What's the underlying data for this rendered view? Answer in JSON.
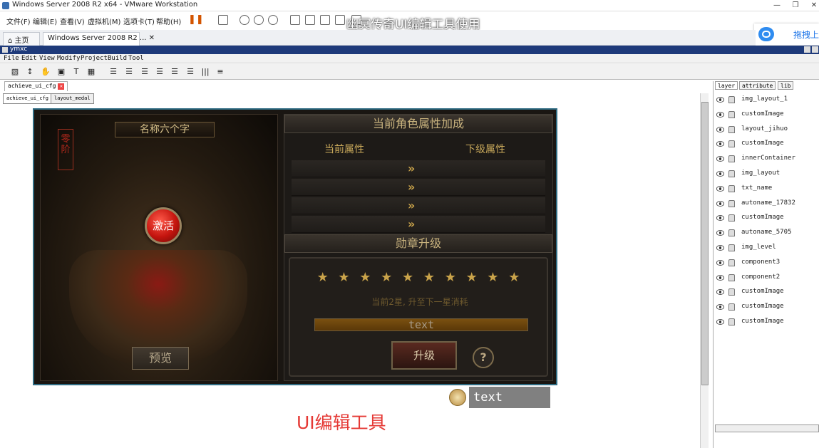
{
  "vmware": {
    "title": "Windows Server 2008 R2 x64 - VMware Workstation",
    "menus": [
      "文件(F)",
      "编辑(E)",
      "查看(V)",
      "虚拟机(M)",
      "选项卡(T)",
      "帮助(H)"
    ],
    "tabs": [
      {
        "label": "主页"
      },
      {
        "label": "Windows Server 2008 R2 ..."
      }
    ]
  },
  "overlay_title": "幽冥传奇UI编辑工具使用",
  "baidu_widget": {
    "label": "拖拽上"
  },
  "app": {
    "title": "ymxc",
    "menus": [
      "File",
      "Edit",
      "View",
      "Modify",
      "Project",
      "Build",
      "Tool"
    ],
    "file_tab": "achieve_ui_cfg",
    "doc_tabs": [
      "achieve_ui_cfg",
      "layout_medal"
    ],
    "panel_tabs": [
      "layer",
      "attribute",
      "lib"
    ],
    "layers": [
      "img_layout_1",
      "customImage",
      "layout_jihuo",
      "customImage",
      "innerContainer",
      "img_layout",
      "txt_name",
      "autoname_17832",
      "customImage",
      "autoname_5705",
      "img_level",
      "component3",
      "component2",
      "customImage",
      "customImage",
      "customImage"
    ]
  },
  "game_ui": {
    "name_label": "名称六个字",
    "level_badge": "零阶",
    "activate_label": "激活",
    "preview_label": "预览",
    "attr_header": "当前角色属性加成",
    "col_current": "当前属性",
    "col_next": "下级属性",
    "arrow": "»",
    "medal_header": "勋章升级",
    "stars": "★ ★ ★ ★ ★ ★ ★ ★ ★ ★",
    "upgrade_info": "当前2星, 升至下一星消耗",
    "progress_text": "text",
    "upgrade_label": "升级",
    "help_label": "?"
  },
  "outside_text": "text",
  "caption": "UI编辑工具"
}
